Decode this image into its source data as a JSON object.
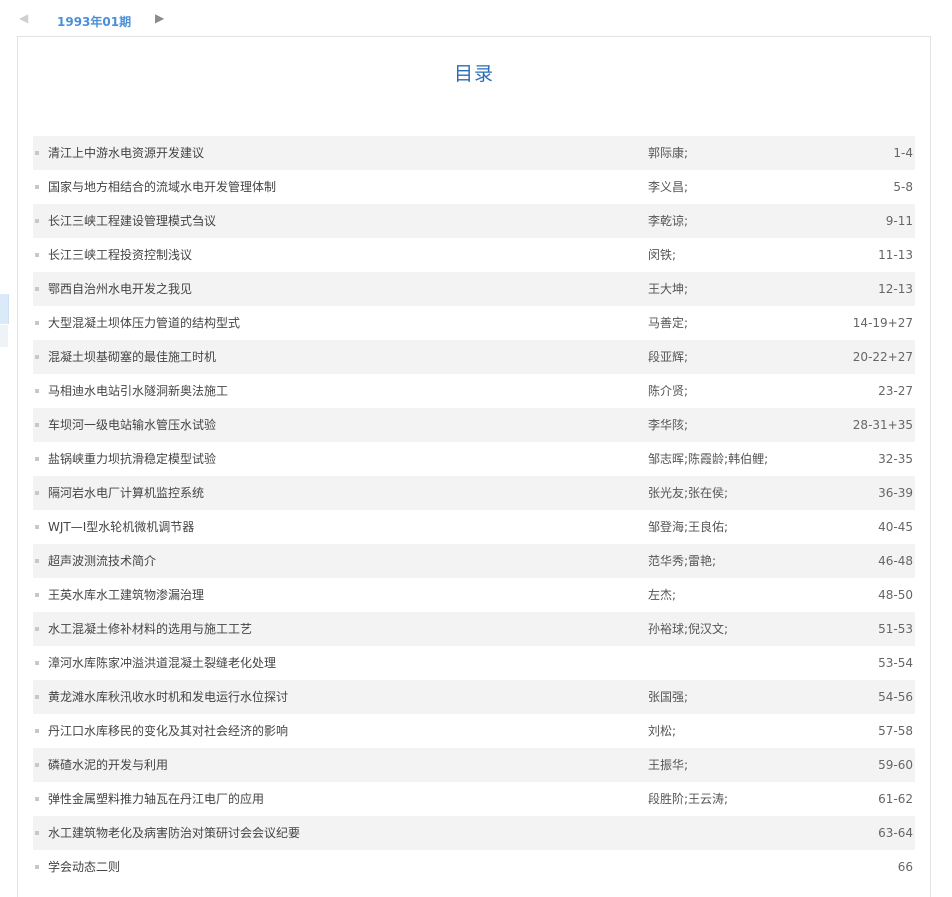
{
  "tab": {
    "prev_icon": "◀",
    "next_icon": "▶",
    "label": "1993年01期"
  },
  "toc_title": "目录",
  "articles": [
    {
      "title": "清江上中游水电资源开发建议",
      "authors": "郭际康;",
      "pages": "1-4"
    },
    {
      "title": "国家与地方相结合的流域水电开发管理体制",
      "authors": "李义昌;",
      "pages": "5-8"
    },
    {
      "title": "长江三峡工程建设管理模式刍议",
      "authors": "李乾谅;",
      "pages": "9-11"
    },
    {
      "title": "长江三峡工程投资控制浅议",
      "authors": "闵铁;",
      "pages": "11-13"
    },
    {
      "title": "鄂西自治州水电开发之我见",
      "authors": "王大坤;",
      "pages": "12-13"
    },
    {
      "title": "大型混凝土坝体压力管道的结构型式",
      "authors": "马善定;",
      "pages": "14-19+27"
    },
    {
      "title": "混凝土坝基砌塞的最佳施工时机",
      "authors": "段亚辉;",
      "pages": "20-22+27"
    },
    {
      "title": "马相迪水电站引水隧洞新奥法施工",
      "authors": "陈介贤;",
      "pages": "23-27"
    },
    {
      "title": "车坝河一级电站输水管压水试验",
      "authors": "李华陔;",
      "pages": "28-31+35"
    },
    {
      "title": "盐锅峡重力坝抗滑稳定模型试验",
      "authors": "邹志晖;陈霞龄;韩伯鲤;",
      "pages": "32-35"
    },
    {
      "title": "隔河岩水电厂计算机监控系统",
      "authors": "张光友;张在侯;",
      "pages": "36-39"
    },
    {
      "title": "WJT—Ⅰ型水轮机微机调节器",
      "authors": "邹登海;王良佑;",
      "pages": "40-45"
    },
    {
      "title": "超声波测流技术简介",
      "authors": "范华秀;雷艳;",
      "pages": "46-48"
    },
    {
      "title": "王英水库水工建筑物渗漏治理",
      "authors": "左杰;",
      "pages": "48-50"
    },
    {
      "title": "水工混凝土修补材料的选用与施工工艺",
      "authors": "孙裕球;倪汉文;",
      "pages": "51-53"
    },
    {
      "title": "漳河水库陈家冲溢洪道混凝土裂缝老化处理",
      "authors": "",
      "pages": "53-54"
    },
    {
      "title": "黄龙滩水库秋汛收水时机和发电运行水位探讨",
      "authors": "张国强;",
      "pages": "54-56"
    },
    {
      "title": "丹江口水库移民的变化及其对社会经济的影响",
      "authors": "刘松;",
      "pages": "57-58"
    },
    {
      "title": "磷碴水泥的开发与利用",
      "authors": "王振华;",
      "pages": "59-60"
    },
    {
      "title": "弹性金属塑料推力轴瓦在丹江电厂的应用",
      "authors": "段胜阶;王云涛;",
      "pages": "61-62"
    },
    {
      "title": "水工建筑物老化及病害防治对策研讨会会议纪要",
      "authors": "",
      "pages": "63-64"
    },
    {
      "title": "学会动态二则",
      "authors": "",
      "pages": "66"
    }
  ]
}
